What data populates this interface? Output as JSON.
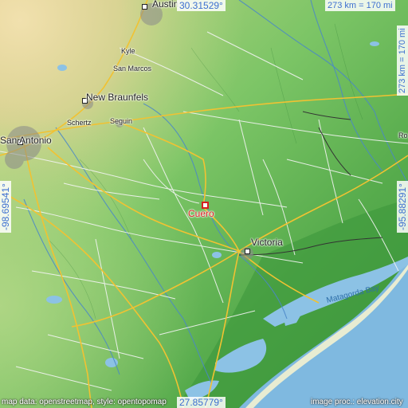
{
  "map": {
    "target_city": "Cuero",
    "cities": [
      {
        "name": "Austin"
      },
      {
        "name": "Kyle"
      },
      {
        "name": "San Marcos"
      },
      {
        "name": "New Braunfels"
      },
      {
        "name": "Schertz"
      },
      {
        "name": "Seguin"
      },
      {
        "name": "San Antonio"
      },
      {
        "name": "Victoria"
      },
      {
        "name": "Ro"
      }
    ],
    "water_labels": [
      {
        "name": "Matagorda Bay"
      }
    ],
    "coords": {
      "top": "30.31529°",
      "bottom": "27.85779°",
      "left": "-98.69541°",
      "right": "-95.88291°"
    },
    "scale": {
      "horizontal": "273 km = 170 mi",
      "vertical": "273 km = 170 mi"
    },
    "credits": {
      "left": "map data: openstreetmap, style: opentopomap",
      "right": "image proc.: elevation.city"
    },
    "colors": {
      "lowland": "#3f9e3f",
      "midland": "#6fc05f",
      "upland": "#e6d59a",
      "sea": "#7fb9e0",
      "highlight": "#e0242a",
      "coord_text": "#3d6fd0"
    }
  }
}
